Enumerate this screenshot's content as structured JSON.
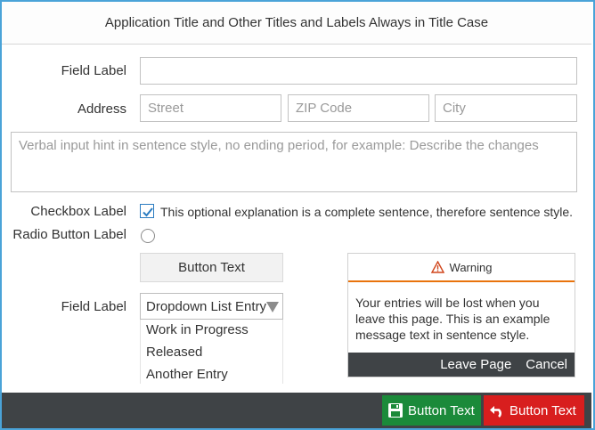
{
  "title": "Application Title and Other Titles and Labels Always in Title Case",
  "form": {
    "field_label": "Field Label",
    "field_value": "",
    "address_label": "Address",
    "street_placeholder": "Street",
    "zip_placeholder": "ZIP Code",
    "city_placeholder": "City",
    "textarea_hint": "Verbal input hint in sentence style, no ending period, for example: Describe the changes",
    "checkbox_label": "Checkbox Label",
    "checkbox_checked": true,
    "checkbox_text": "This optional explanation is a complete sentence, therefore sentence style.",
    "radio_label": "Radio Button Label",
    "button_text": "Button Text",
    "dropdown_label": "Field Label",
    "dropdown_selected": "Dropdown List Entry",
    "dropdown_options": [
      "Work in Progress",
      "Released",
      "Another Entry"
    ]
  },
  "message": {
    "title": "Warning",
    "body": "Your entries will be lost when you leave this page. This is an example message text in sentence style.",
    "primary_action": "Leave Page",
    "secondary_action": "Cancel",
    "accent_color": "#e9730c"
  },
  "footer": {
    "save_label": "Button Text",
    "undo_label": "Button Text",
    "save_color": "#1b8a3a",
    "undo_color": "#d81e1e"
  },
  "icons": {
    "warning": "warning-triangle-icon",
    "save": "floppy-disk-icon",
    "undo": "undo-arrow-icon",
    "checkbox": "checkmark-icon"
  }
}
